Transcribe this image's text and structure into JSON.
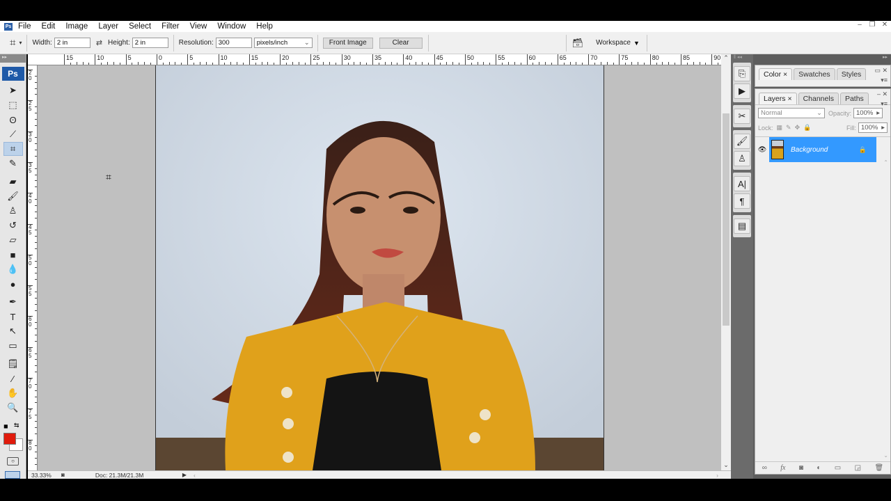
{
  "app": {
    "logo": "Ps"
  },
  "menu": [
    "File",
    "Edit",
    "Image",
    "Layer",
    "Select",
    "Filter",
    "View",
    "Window",
    "Help"
  ],
  "window_controls": {
    "minimize": "–",
    "restore": "❐",
    "close": "✕"
  },
  "options": {
    "width_label": "Width:",
    "width_value": "2 in",
    "height_label": "Height:",
    "height_value": "2 in",
    "resolution_label": "Resolution:",
    "resolution_value": "300",
    "resolution_unit": "pixels/inch",
    "front_image": "Front Image",
    "clear": "Clear",
    "workspace": "Workspace"
  },
  "ruler_h": [
    "15",
    "10",
    "5",
    "0",
    "5",
    "10",
    "15",
    "20",
    "25",
    "30",
    "35",
    "40",
    "45",
    "50",
    "55",
    "60",
    "65",
    "70",
    "75",
    "80",
    "85",
    "90"
  ],
  "ruler_v": [
    "20",
    "25",
    "30",
    "35",
    "40",
    "45",
    "50",
    "55",
    "60",
    "65",
    "70",
    "75",
    "80"
  ],
  "tools": [
    {
      "name": "move-tool",
      "glyph": "➤"
    },
    {
      "name": "marquee-tool",
      "glyph": "⬚"
    },
    {
      "name": "lasso-tool",
      "glyph": "ʘ"
    },
    {
      "name": "magic-wand-tool",
      "glyph": "⟋"
    },
    {
      "name": "crop-tool",
      "glyph": "⌗",
      "selected": true
    },
    {
      "name": "slice-tool",
      "glyph": "✎"
    },
    {
      "name": "healing-brush-tool",
      "glyph": "▰"
    },
    {
      "name": "brush-tool",
      "glyph": "🖌"
    },
    {
      "name": "clone-stamp-tool",
      "glyph": "♙"
    },
    {
      "name": "history-brush-tool",
      "glyph": "↺"
    },
    {
      "name": "eraser-tool",
      "glyph": "▱"
    },
    {
      "name": "gradient-tool",
      "glyph": "■"
    },
    {
      "name": "blur-tool",
      "glyph": "💧"
    },
    {
      "name": "dodge-tool",
      "glyph": "●"
    },
    {
      "name": "pen-tool",
      "glyph": "✒"
    },
    {
      "name": "type-tool",
      "glyph": "T"
    },
    {
      "name": "path-selection-tool",
      "glyph": "↖"
    },
    {
      "name": "shape-tool",
      "glyph": "▭"
    },
    {
      "name": "notes-tool",
      "glyph": "🗒"
    },
    {
      "name": "eyedropper-tool",
      "glyph": "⁄"
    },
    {
      "name": "hand-tool",
      "glyph": "✋"
    },
    {
      "name": "zoom-tool",
      "glyph": "🔍"
    }
  ],
  "colors": {
    "foreground": "#e01b0c",
    "background": "#ffffff",
    "accent": "#3399ff"
  },
  "status": {
    "zoom": "33.33%",
    "doc": "Doc: 21.3M/21.3M"
  },
  "panels": {
    "color_group": [
      "Color",
      "Swatches",
      "Styles"
    ],
    "layers_group": [
      "Layers",
      "Channels",
      "Paths"
    ],
    "blend_mode": "Normal",
    "opacity_label": "Opacity:",
    "opacity_value": "100%",
    "lock_label": "Lock:",
    "fill_label": "Fill:",
    "fill_value": "100%",
    "layers": [
      {
        "name": "Background",
        "visible": true,
        "locked": true,
        "selected": true
      }
    ]
  },
  "dock_icons": [
    "history",
    "actions",
    "tool-presets",
    "brushes",
    "clone-source",
    "character",
    "paragraph",
    "layer-comps"
  ]
}
